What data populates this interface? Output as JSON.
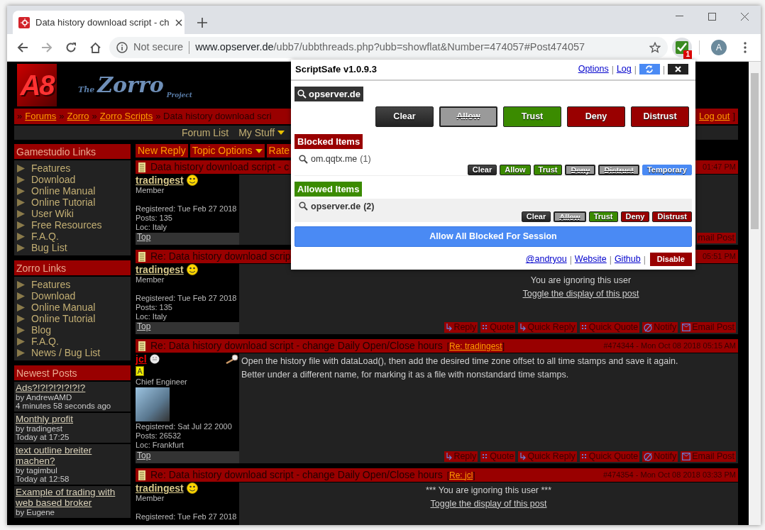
{
  "browser": {
    "tab_title": "Data history download script - ch",
    "security_label": "Not secure",
    "url_host": "www.opserver.de",
    "url_path": "/ubb7/ubbthreads.php?ubb=showflat&Number=474057#Post474057",
    "extension_badge": "1",
    "profile_initial": "A"
  },
  "forum": {
    "logo": {
      "emblem": "A8",
      "line_1": "The",
      "line_2": "Zorro",
      "line_3": "Project"
    },
    "breadcrumb": [
      {
        "label": "»",
        "kind": "sep"
      },
      {
        "label": "Forums",
        "kind": "link"
      },
      {
        "label": "»",
        "kind": "sep"
      },
      {
        "label": "Zorro",
        "kind": "link"
      },
      {
        "label": "»",
        "kind": "sep"
      },
      {
        "label": "Zorro Scripts",
        "kind": "link"
      },
      {
        "label": "» Data history download scri",
        "kind": "text"
      }
    ],
    "logout": {
      "label": "Log out",
      "bracket": "]"
    },
    "nav": [
      {
        "label": "Forum List",
        "dropdown": false
      },
      {
        "label": "My Stuff",
        "dropdown": true
      }
    ],
    "sidebar": [
      {
        "title": "Gamestudio Links",
        "kind": "links",
        "items": [
          "Features",
          "Download",
          "Online Manual",
          "Online Tutorial",
          "User Wiki",
          "Free Resources",
          "F.A.Q.",
          "Bug List"
        ]
      },
      {
        "title": "Zorro Links",
        "kind": "links",
        "items": [
          "Features",
          "Download",
          "Online Manual",
          "Online Tutorial",
          "Blog",
          "F.A.Q.",
          "News / Bug List"
        ]
      },
      {
        "title": "Newest Posts",
        "kind": "posts",
        "items": [
          {
            "title": "Ads?!?!?!?!?!?!?",
            "by": "by AndrewAMD",
            "time": "4 minutes 58 seconds ago"
          },
          {
            "title": "Monthly profit",
            "by": "by tradingest",
            "time": "Today at 17:25"
          },
          {
            "title": "text outline breiter machen?",
            "by": "by tagimbul",
            "time": "Today at 12:58"
          },
          {
            "title": "Example of trading with web based broker",
            "by": "by Eugene"
          }
        ]
      }
    ],
    "thread_tools": [
      {
        "label": "New Reply",
        "dropdown": false
      },
      {
        "label": "Topic Options",
        "dropdown": true
      },
      {
        "label": "Rate",
        "dropdown": false
      }
    ],
    "posts": [
      {
        "title": "Data history download script - c",
        "date": "01:47 PM",
        "user": {
          "name": "tradingest",
          "kind": "member",
          "role": "Member",
          "registered": "Registered: Tue Feb 27 2018",
          "posts": "Posts: 135",
          "loc": "Loc: Italy"
        },
        "top": "Top",
        "actions": [
          {
            "label": "mail Post",
            "kind": "email"
          }
        ]
      },
      {
        "title": "Re: Data history download scrip",
        "date": "05:51 PM",
        "user": {
          "name": "tradingest",
          "kind": "member",
          "role": "Member",
          "registered": "Registered: Tue Feb 27 2018",
          "posts": "Posts: 135",
          "loc": "Loc: Italy"
        },
        "top": "Top",
        "ignored": "You are ignoring this user",
        "toggle": "Toggle the display of this post",
        "actions": [
          {
            "label": "Reply",
            "kind": "reply"
          },
          {
            "label": "Quote",
            "kind": "quote"
          },
          {
            "label": "Quick Reply",
            "kind": "reply"
          },
          {
            "label": "Quick Quote",
            "kind": "quote"
          },
          {
            "label": "Notify",
            "kind": "notify"
          },
          {
            "label": "Email Post",
            "kind": "email"
          }
        ]
      },
      {
        "title": "Re: Data history download script - change Daily Open/Close hours",
        "reply_to": {
          "open": "[",
          "label": "Re: tradingest",
          "close": "]"
        },
        "date": "#474344 - Mon Oct 08 2018 05:15 AM",
        "user": {
          "name": "jcl",
          "kind": "admin",
          "role": "Chief Engineer",
          "registered": "Registered: Sat Jul 22 2000",
          "posts": "Posts: 26532",
          "loc": "Loc: Frankfurt"
        },
        "top": "Top",
        "body": [
          "Open the history file with dataLoad(), then add the desired time zone offset to all time stamps and save it again.",
          "Better under a different name, for marking it as a file with nonstandard time stamps."
        ],
        "actions": [
          {
            "label": "Reply",
            "kind": "reply"
          },
          {
            "label": "Quote",
            "kind": "quote"
          },
          {
            "label": "Quick Reply",
            "kind": "reply"
          },
          {
            "label": "Quick Quote",
            "kind": "quote"
          },
          {
            "label": "Notify",
            "kind": "notify"
          },
          {
            "label": "Email Post",
            "kind": "email"
          }
        ]
      },
      {
        "title": "Re: Data history download script - change Daily Open/Close hours",
        "reply_to": {
          "open": "[",
          "label": "Re: jcl",
          "close": "]"
        },
        "date": "#474354 - Mon Oct 08 2018 03:33 PM",
        "user": {
          "name": "tradingest",
          "kind": "member",
          "role": "Member",
          "registered": "Registered: Tue Feb 27 2018"
        },
        "ignored": "*** You are ignoring this user ***",
        "toggle": "Toggle the display of this post"
      }
    ]
  },
  "popup": {
    "title": "ScriptSafe v1.0.9.3",
    "separator": "|",
    "header_links": [
      "Options",
      "Log"
    ],
    "site": {
      "domain": "opserver.de",
      "buttons": [
        {
          "label": "Clear",
          "kind": "clear",
          "selected": false
        },
        {
          "label": "Allow",
          "kind": "allow",
          "selected": true
        },
        {
          "label": "Trust",
          "kind": "trust",
          "selected": false
        },
        {
          "label": "Deny",
          "kind": "deny",
          "selected": false
        },
        {
          "label": "Distrust",
          "kind": "distrust",
          "selected": false
        }
      ]
    },
    "sections": [
      {
        "title": "Blocked Items",
        "kind": "blocked",
        "items": [
          {
            "domain": "om.qqtx.me",
            "count": "(1)",
            "buttons": [
              {
                "label": "Clear",
                "kind": "clear",
                "selected": false
              },
              {
                "label": "Allow",
                "kind": "allow",
                "selected": false
              },
              {
                "label": "Trust",
                "kind": "trust",
                "selected": false
              },
              {
                "label": "Deny",
                "kind": "deny",
                "selected": true
              },
              {
                "label": "Distrust",
                "kind": "distrust",
                "selected": true
              },
              {
                "label": "Temporary",
                "kind": "temporary",
                "selected": false
              }
            ]
          }
        ]
      },
      {
        "title": "Allowed Items",
        "kind": "allowed",
        "items": [
          {
            "domain": "opserver.de",
            "count": "(2)",
            "buttons": [
              {
                "label": "Clear",
                "kind": "clear",
                "selected": false
              },
              {
                "label": "Allow",
                "kind": "allow",
                "selected": true
              },
              {
                "label": "Trust",
                "kind": "trust",
                "selected": false
              },
              {
                "label": "Deny",
                "kind": "deny",
                "selected": false
              },
              {
                "label": "Distrust",
                "kind": "distrust",
                "selected": false
              }
            ]
          }
        ]
      }
    ],
    "allow_all": "Allow All Blocked For Session",
    "footer_links": [
      "@andryou",
      "Website",
      "Github"
    ],
    "disable": "Disable"
  }
}
